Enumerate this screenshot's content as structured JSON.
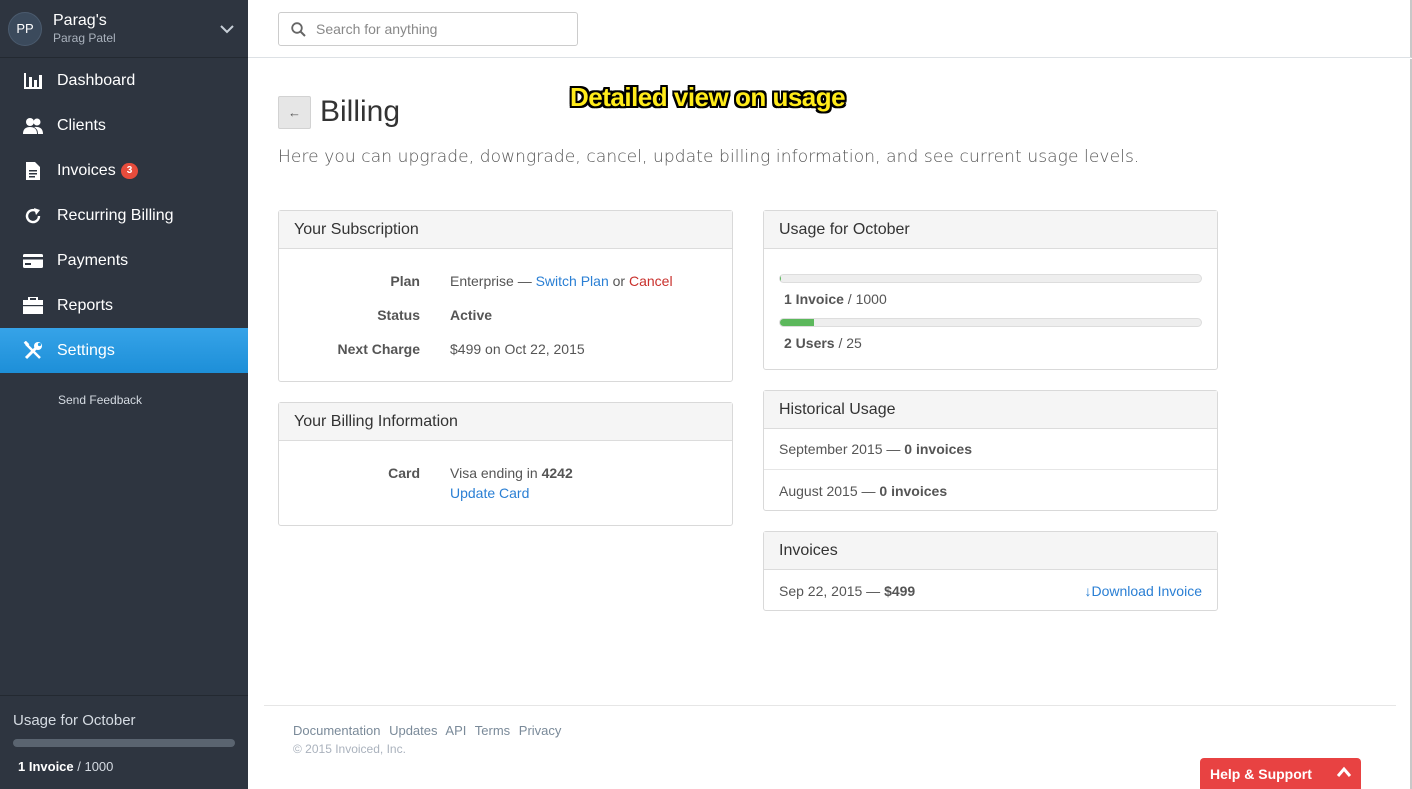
{
  "account": {
    "initials": "PP",
    "name": "Parag's",
    "user": "Parag Patel"
  },
  "sidebar": {
    "items": [
      {
        "label": "Dashboard",
        "icon": "bar-chart-icon"
      },
      {
        "label": "Clients",
        "icon": "users-icon"
      },
      {
        "label": "Invoices",
        "icon": "document-icon",
        "badge": "3"
      },
      {
        "label": "Recurring Billing",
        "icon": "refresh-icon"
      },
      {
        "label": "Payments",
        "icon": "credit-card-icon"
      },
      {
        "label": "Reports",
        "icon": "briefcase-icon"
      },
      {
        "label": "Settings",
        "icon": "tools-icon",
        "active": true
      }
    ],
    "send_feedback": "Send Feedback",
    "usage": {
      "title": "Usage for October",
      "value": "1 Invoice",
      "limit": " / 1000",
      "fraction": 0.001
    }
  },
  "search": {
    "placeholder": "Search for anything"
  },
  "page": {
    "back_label": "←",
    "title": "Billing",
    "annotation": "Detailed view on usage",
    "subtitle": "Here you can upgrade, downgrade, cancel, update billing information, and see current usage levels."
  },
  "subscription": {
    "heading": "Your Subscription",
    "plan_label": "Plan",
    "plan_value": "Enterprise — ",
    "switch_plan": "Switch Plan",
    "or": " or ",
    "cancel": "Cancel",
    "status_label": "Status",
    "status_value": "Active",
    "next_charge_label": "Next Charge",
    "next_charge_value": "$499 on Oct 22, 2015"
  },
  "billing_info": {
    "heading": "Your Billing Information",
    "card_label": "Card",
    "card_prefix": "Visa ending in ",
    "card_last4": "4242",
    "update_card": "Update Card"
  },
  "usage": {
    "heading": "Usage for October",
    "invoices": {
      "value": "1 Invoice",
      "limit": " / 1000",
      "fraction": 0.001
    },
    "users": {
      "value": "2 Users",
      "limit": " / 25",
      "fraction": 0.08
    }
  },
  "historical": {
    "heading": "Historical Usage",
    "rows": [
      {
        "period": "September 2015 — ",
        "count": "0 invoices"
      },
      {
        "period": "August 2015 — ",
        "count": "0 invoices"
      }
    ]
  },
  "invoices": {
    "heading": "Invoices",
    "rows": [
      {
        "date": "Sep 22, 2015 — ",
        "amount": "$499",
        "download": "Download Invoice"
      }
    ]
  },
  "footer": {
    "links": [
      "Documentation",
      "Updates",
      "API",
      "Terms",
      "Privacy"
    ],
    "copyright": "© 2015 Invoiced, Inc."
  },
  "help": {
    "label": "Help & Support"
  },
  "colors": {
    "sidebar": "#2e3540",
    "accent": "#1d8fd8",
    "success": "#5cb85c",
    "danger": "#e84242"
  }
}
